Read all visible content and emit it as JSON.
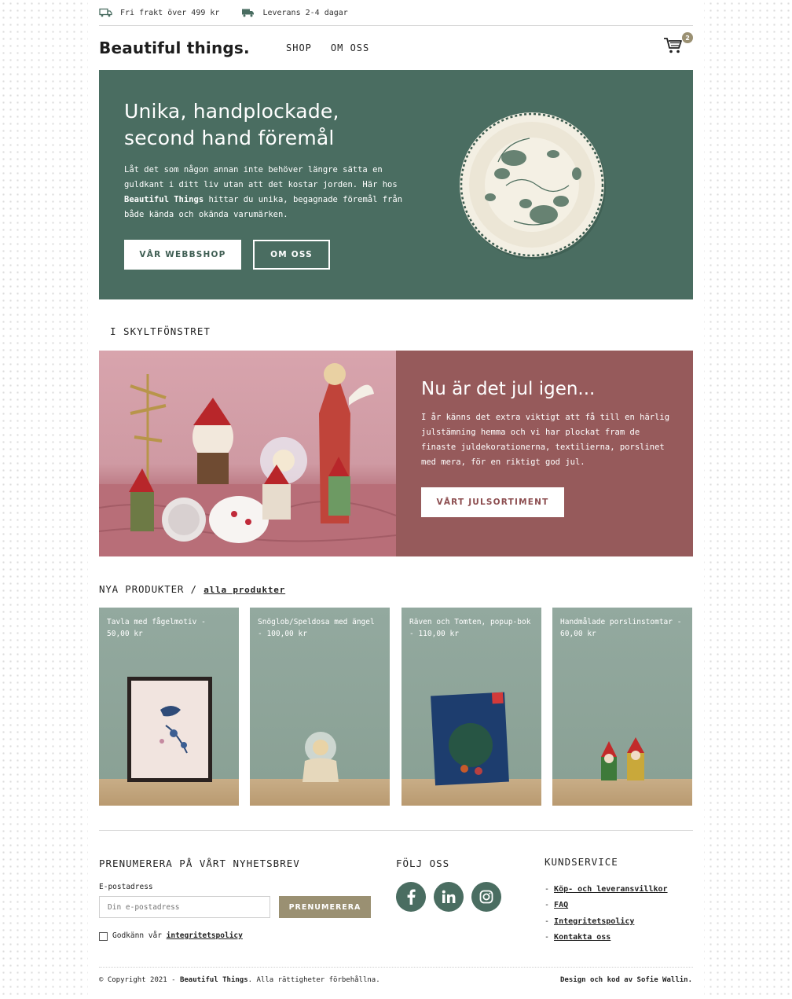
{
  "topbar": {
    "shipping_free": "Fri frakt över 499 kr",
    "delivery": "Leverans 2-4 dagar"
  },
  "header": {
    "logo": "Beautiful things.",
    "nav": [
      "SHOP",
      "OM OSS"
    ],
    "cart_count": "2"
  },
  "hero": {
    "title": "Unika, handplockade, second hand föremål",
    "text_before": "Låt det som någon annan inte behöver längre sätta en guldkant i ditt liv utan att det kostar jorden. Här hos ",
    "text_bold": "Beautiful Things",
    "text_after": " hittar du unika, begagnade föremål från både kända och okända varumärken.",
    "btn_shop": "VÅR WEBBSHOP",
    "btn_about": "OM OSS",
    "bg_color": "#4a6d61"
  },
  "window_section": {
    "title": "I SKYLTFÖNSTRET",
    "heading": "Nu är det jul igen...",
    "text": "I år känns det extra viktigt att få till en härlig julstämning hemma och vi har plockat fram de finaste juldekorationerna, textilierna, porslinet med mera, för en riktigt god jul.",
    "button": "VÅRT JULSORTIMENT",
    "panel_color": "#965a5b"
  },
  "products": {
    "title": "NYA PRODUKTER /",
    "all_link": "alla produkter",
    "items": [
      {
        "label": "Tavla med fågelmotiv - 50,00 kr"
      },
      {
        "label": "Snöglob/Speldosa med ängel - 100,00 kr"
      },
      {
        "label": "Räven och Tomten, popup-bok - 110,00 kr"
      },
      {
        "label": "Handmålade porslinstomtar - 60,00 kr"
      }
    ]
  },
  "newsletter": {
    "title": "PRENUMERERA PÅ VÅRT NYHETSBREV",
    "email_label": "E-postadress",
    "email_placeholder": "Din e-postadress",
    "button": "PRENUMERERA",
    "consent_text": "Godkänn vår ",
    "consent_link": "integritetspolicy"
  },
  "follow": {
    "title": "FÖLJ OSS",
    "icons": [
      "facebook-icon",
      "linkedin-icon",
      "instagram-icon"
    ]
  },
  "service": {
    "title": "KUNDSERVICE",
    "links": [
      "Köp- och leveransvillkor",
      "FAQ",
      "Integritetspolicy",
      "Kontakta oss"
    ]
  },
  "footer": {
    "copy_before": "© Copyright 2021 - ",
    "copy_bold": "Beautiful Things",
    "copy_after": ". Alla rättigheter förbehållna.",
    "credit": "Design och kod av Sofie Wallin."
  },
  "colors": {
    "accent_green": "#4a6d61",
    "accent_rose": "#965a5b",
    "accent_khaki": "#9a9072"
  }
}
